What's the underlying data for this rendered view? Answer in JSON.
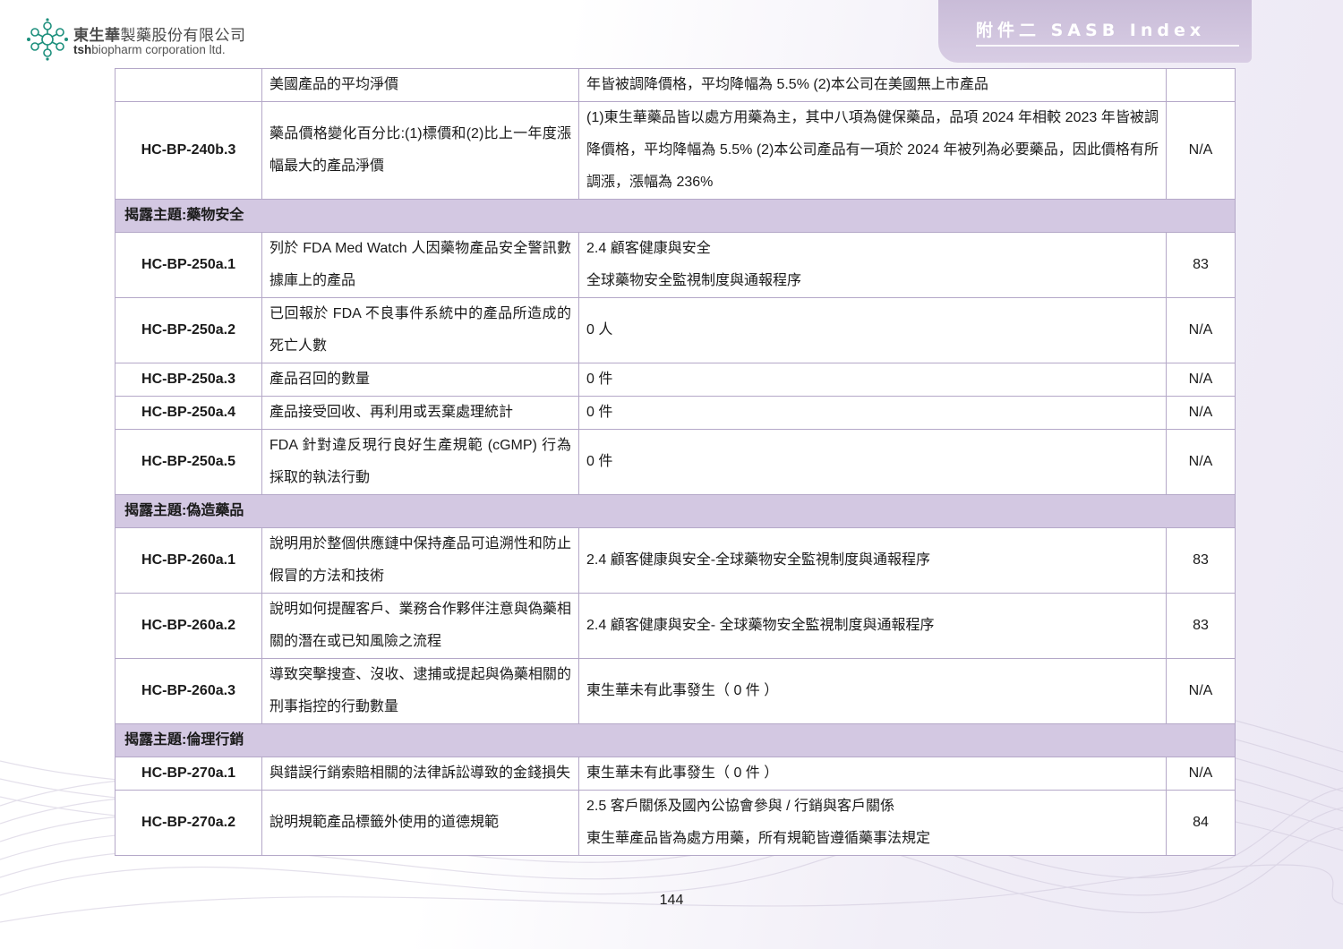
{
  "header": {
    "company_cn_bold": "東生華",
    "company_cn_rest": "製藥股份有限公司",
    "company_en_bold": "tsh",
    "company_en_rest": "biopharm corporation ltd.",
    "section_title": "附件二 SASB Index"
  },
  "colors": {
    "section_bg": "#d3c8e2",
    "header_tab": "#c9bcd8",
    "border": "#b4a8c8"
  },
  "rows": [
    {
      "type": "data",
      "code": "",
      "metric": "美國產品的平均淨價",
      "response": [
        "年皆被調降價格，平均降幅為 5.5% (2)本公司在美國無上市產品"
      ],
      "page": ""
    },
    {
      "type": "data",
      "code": "HC-BP-240b.3",
      "metric": "藥品價格變化百分比:(1)標價和(2)比上一年度漲幅最大的產品淨價",
      "response": [
        "(1)東生華藥品皆以處方用藥為主，其中八項為健保藥品，品項 2024 年相較 2023 年皆被調降價格，平均降幅為 5.5% (2)本公司產品有一項於 2024 年被列為必要藥品，因此價格有所調漲，漲幅為 236%"
      ],
      "page": "N/A"
    },
    {
      "type": "section",
      "label": "揭露主題:藥物安全"
    },
    {
      "type": "data",
      "code": "HC-BP-250a.1",
      "metric": "列於 FDA Med Watch 人因藥物產品安全警訊數據庫上的產品",
      "response": [
        "2.4 顧客健康與安全",
        "全球藥物安全監視制度與通報程序"
      ],
      "page": "83"
    },
    {
      "type": "data",
      "code": "HC-BP-250a.2",
      "metric": "已回報於 FDA 不良事件系統中的產品所造成的死亡人數",
      "response": [
        "0 人"
      ],
      "page": "N/A"
    },
    {
      "type": "data",
      "code": "HC-BP-250a.3",
      "metric": "產品召回的數量",
      "response": [
        "0 件"
      ],
      "page": "N/A"
    },
    {
      "type": "data",
      "code": "HC-BP-250a.4",
      "metric": "產品接受回收、再利用或丟棄處理統計",
      "response": [
        "0 件"
      ],
      "page": "N/A"
    },
    {
      "type": "data",
      "code": "HC-BP-250a.5",
      "metric": "FDA 針對違反現行良好生產規範 (cGMP) 行為採取的執法行動",
      "response": [
        "0 件"
      ],
      "page": "N/A"
    },
    {
      "type": "section",
      "label": "揭露主題:偽造藥品"
    },
    {
      "type": "data",
      "code": "HC-BP-260a.1",
      "metric": "說明用於整個供應鏈中保持產品可追溯性和防止假冒的方法和技術",
      "response": [
        "2.4 顧客健康與安全-全球藥物安全監視制度與通報程序"
      ],
      "page": "83"
    },
    {
      "type": "data",
      "code": "HC-BP-260a.2",
      "metric": "說明如何提醒客戶、業務合作夥伴注意與偽藥相關的潛在或已知風險之流程",
      "response": [
        "2.4 顧客健康與安全- 全球藥物安全監視制度與通報程序"
      ],
      "page": "83"
    },
    {
      "type": "data",
      "code": "HC-BP-260a.3",
      "metric": "導致突擊搜查、沒收、逮捕或提起與偽藥相關的刑事指控的行動數量",
      "response": [
        "東生華未有此事發生（ 0 件 ）"
      ],
      "page": "N/A"
    },
    {
      "type": "section",
      "label": "揭露主題:倫理行銷"
    },
    {
      "type": "data",
      "code": "HC-BP-270a.1",
      "metric": "與錯誤行銷索賠相關的法律訴訟導致的金錢損失",
      "response": [
        "東生華未有此事發生（ 0 件 ）"
      ],
      "page": "N/A"
    },
    {
      "type": "data",
      "code": "HC-BP-270a.2",
      "metric": "說明規範產品標籤外使用的道德規範",
      "response": [
        "2.5 客戶關係及國內公協會參與 / 行銷與客戶關係",
        "東生華產品皆為處方用藥，所有規範皆遵循藥事法規定"
      ],
      "page": "84"
    }
  ],
  "footer": {
    "page_number": "144"
  }
}
